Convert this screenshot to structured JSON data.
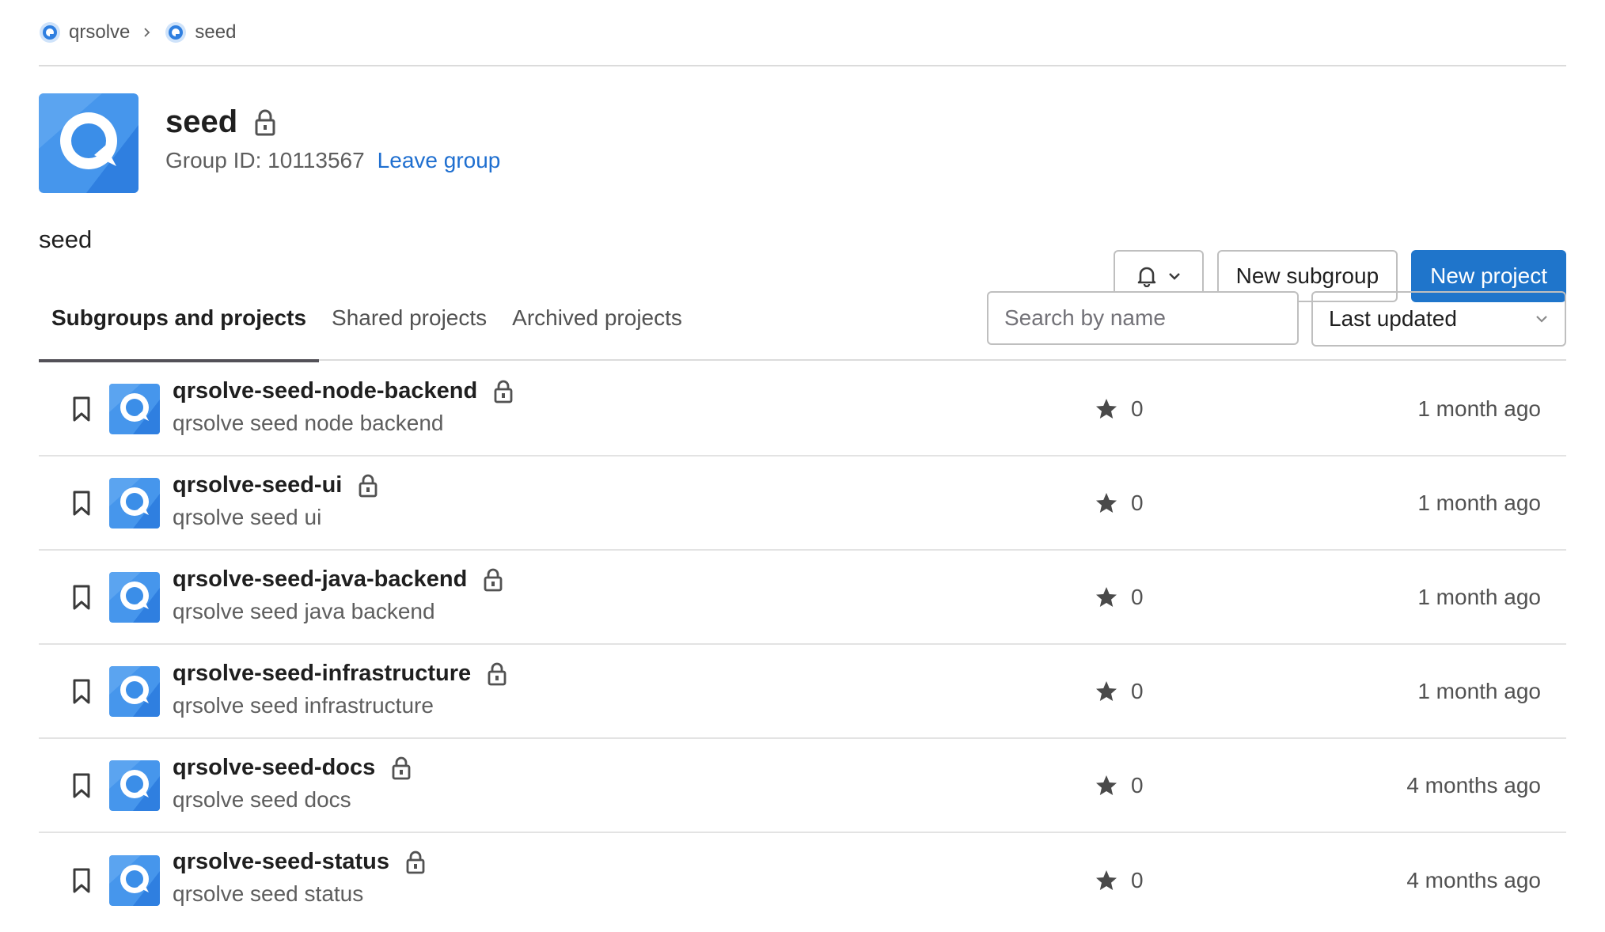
{
  "breadcrumb": {
    "items": [
      {
        "label": "qrsolve"
      },
      {
        "label": "seed"
      }
    ]
  },
  "group": {
    "name": "seed",
    "id_label": "Group ID: 10113567",
    "leave_label": "Leave group",
    "description": "seed"
  },
  "actions": {
    "new_subgroup": "New subgroup",
    "new_project": "New project"
  },
  "tabs": [
    {
      "label": "Subgroups and projects",
      "active": true
    },
    {
      "label": "Shared projects",
      "active": false
    },
    {
      "label": "Archived projects",
      "active": false
    }
  ],
  "search": {
    "placeholder": "Search by name",
    "value": ""
  },
  "sort": {
    "selected": "Last updated"
  },
  "projects": [
    {
      "name": "qrsolve-seed-node-backend",
      "description": "qrsolve seed node backend",
      "stars": "0",
      "updated": "1 month ago"
    },
    {
      "name": "qrsolve-seed-ui",
      "description": "qrsolve seed ui",
      "stars": "0",
      "updated": "1 month ago"
    },
    {
      "name": "qrsolve-seed-java-backend",
      "description": "qrsolve seed java backend",
      "stars": "0",
      "updated": "1 month ago"
    },
    {
      "name": "qrsolve-seed-infrastructure",
      "description": "qrsolve seed infrastructure",
      "stars": "0",
      "updated": "1 month ago"
    },
    {
      "name": "qrsolve-seed-docs",
      "description": "qrsolve seed docs",
      "stars": "0",
      "updated": "4 months ago"
    },
    {
      "name": "qrsolve-seed-status",
      "description": "qrsolve seed status",
      "stars": "0",
      "updated": "4 months ago"
    }
  ],
  "colors": {
    "primary": "#1f75cb",
    "link": "#1f6fd0",
    "logo_blue": "#3b8ee8"
  }
}
